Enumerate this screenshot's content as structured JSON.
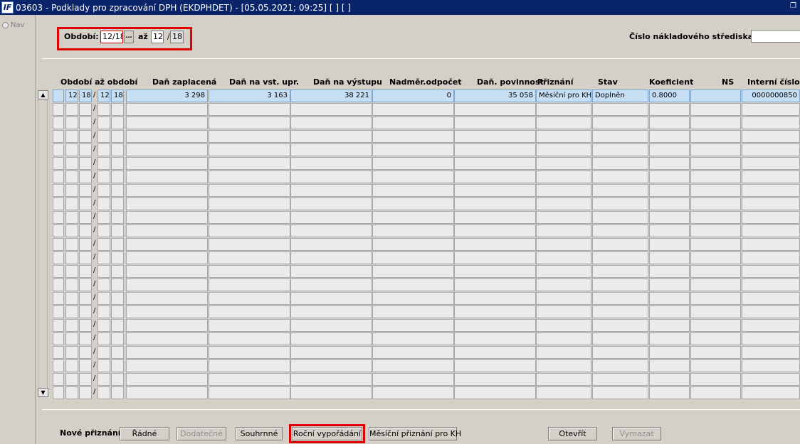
{
  "window": {
    "title": "03603 - Podklady pro zpracování DPH (EKDPHDET) - [05.05.2021; 09:25]  [ ]  [ ]",
    "icon_text": "IF",
    "restore_icon": "restore-icon"
  },
  "nav": {
    "label": "Nav"
  },
  "filter": {
    "period_label": "Období:",
    "period_from": "12/18",
    "lov_label": "…",
    "to_label": "až",
    "period_to_month": "12",
    "period_to_sep": "/",
    "period_to_year": "18",
    "cost_center_label": "Číslo nákladového střediska",
    "cost_center_value": ""
  },
  "table": {
    "headers": {
      "period": "Období až období",
      "paid": "Daň zaplacená",
      "input": "Daň na vst. upr.",
      "output": "Daň na výstupu",
      "excess": "Nadměr.odpočet",
      "liability": "Daň. povinnost",
      "declaration": "Přiznání",
      "status": "Stav",
      "coef": "Koeficient",
      "ns": "NS",
      "internal": "Interní číslo"
    },
    "rows": [
      {
        "m1": "12",
        "y1": "18",
        "sep": "/",
        "m2": "12",
        "y2": "18",
        "paid": "3 298",
        "input": "3 163",
        "output": "38 221",
        "excess": "0",
        "liability": "35 058",
        "declaration": "Měsíční pro KH",
        "status": "Doplněn",
        "coef": "0.8000",
        "ns": "",
        "internal": "0000000850"
      }
    ],
    "empty_sep": "/",
    "empty_rows": 22
  },
  "footer": {
    "new_label": "Nové přiznání",
    "buttons": {
      "regular": "Řádné",
      "supplementary": "Dodatečné",
      "summary": "Souhrnné",
      "annual": "Roční vypořádání",
      "monthly_kh": "Měsíční přiznání pro KH",
      "open": "Otevřít",
      "delete": "Vymazat"
    }
  },
  "colors": {
    "highlight": "#e00000",
    "selected_row": "#c6dff5",
    "titlebar": "#0a246a"
  }
}
